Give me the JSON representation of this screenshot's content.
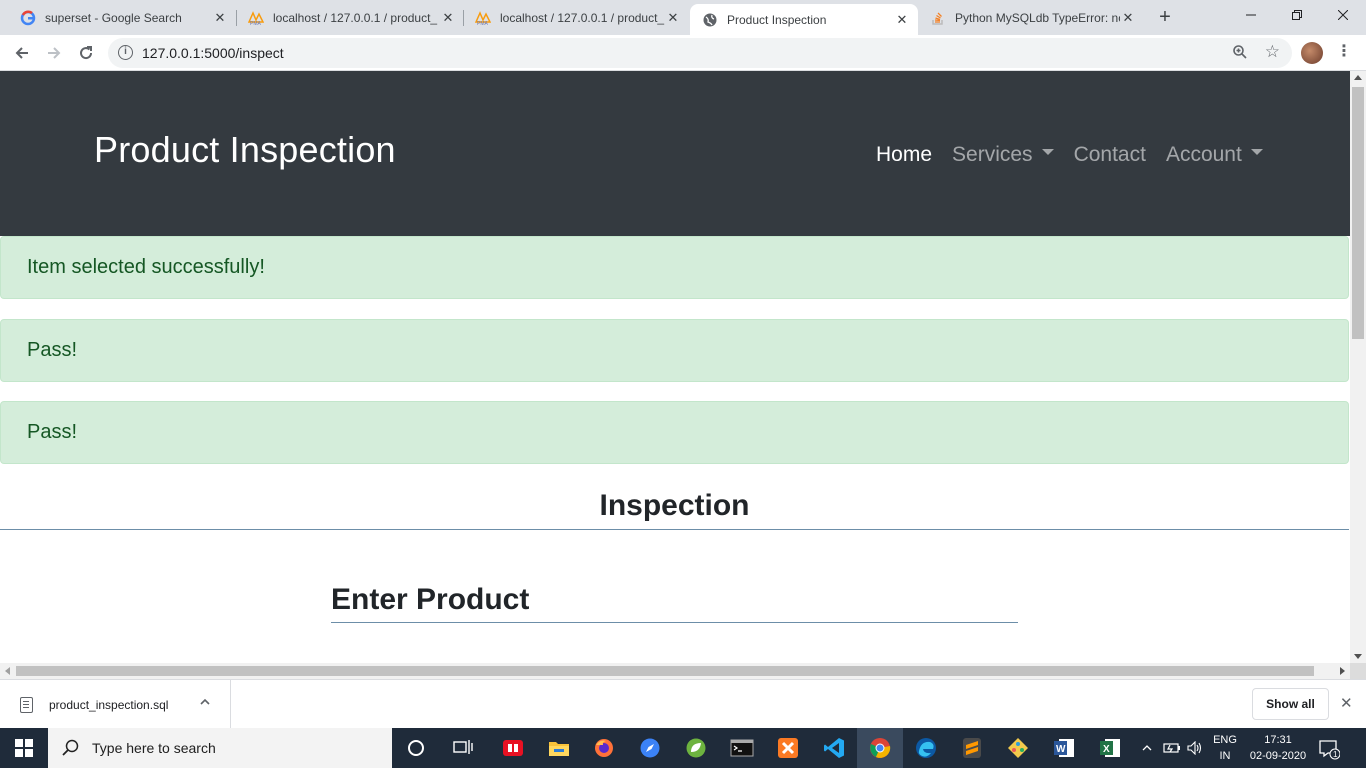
{
  "browser": {
    "tabs": [
      {
        "title": "superset - Google Search",
        "active": false
      },
      {
        "title": "localhost / 127.0.0.1 / product_",
        "active": false
      },
      {
        "title": "localhost / 127.0.0.1 / product_",
        "active": false
      },
      {
        "title": "Product Inspection",
        "active": true
      },
      {
        "title": "Python MySQLdb TypeError: nc",
        "active": false
      }
    ],
    "url": "127.0.0.1:5000/inspect"
  },
  "site": {
    "brand": "Product Inspection",
    "nav": {
      "home": "Home",
      "services": "Services",
      "contact": "Contact",
      "account": "Account"
    }
  },
  "alerts": [
    "Item selected successfully!",
    "Pass!",
    "Pass!"
  ],
  "main": {
    "section_title": "Inspection",
    "subsection_title": "Enter Product"
  },
  "downloads": {
    "file_name": "product_inspection.sql",
    "show_all": "Show all"
  },
  "taskbar": {
    "search_placeholder": "Type here to search",
    "lang_line1": "ENG",
    "lang_line2": "IN",
    "time": "17:31",
    "date": "02-09-2020",
    "notifications": "1"
  },
  "colors": {
    "navbar_bg": "#343a40",
    "alert_bg": "#d4edda",
    "alert_text": "#155724",
    "taskbar_bg": "#1f2b3a"
  }
}
